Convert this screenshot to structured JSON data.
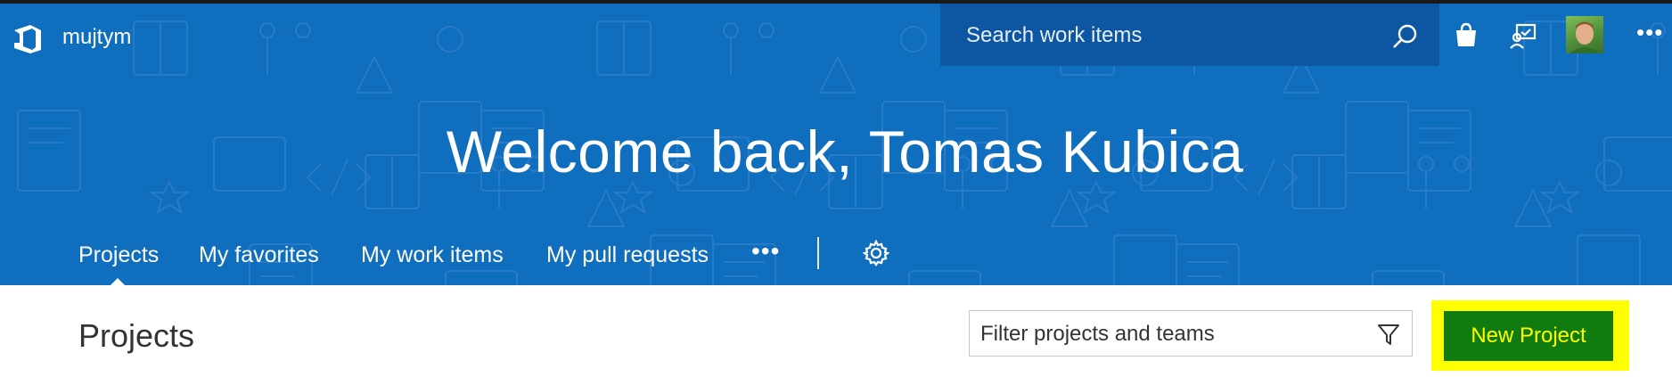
{
  "header": {
    "org_name": "mujtym",
    "search_placeholder": "Search work items",
    "icons": [
      "azure-devops-logo",
      "search-icon",
      "marketplace-bag-icon",
      "feedback-icon",
      "user-avatar",
      "more-icon"
    ],
    "more_label": "•••"
  },
  "banner": {
    "welcome": "Welcome back, Tomas Kubica",
    "background_color": "#106ebe"
  },
  "nav": {
    "tabs": [
      {
        "label": "Projects",
        "active": true
      },
      {
        "label": "My favorites",
        "active": false
      },
      {
        "label": "My work items",
        "active": false
      },
      {
        "label": "My pull requests",
        "active": false
      }
    ],
    "more_label": "•••"
  },
  "main": {
    "title": "Projects",
    "filter_placeholder": "Filter projects and teams",
    "new_project_label": "New Project",
    "new_project_color": "#107c10",
    "highlight_color": "#ffff00"
  }
}
